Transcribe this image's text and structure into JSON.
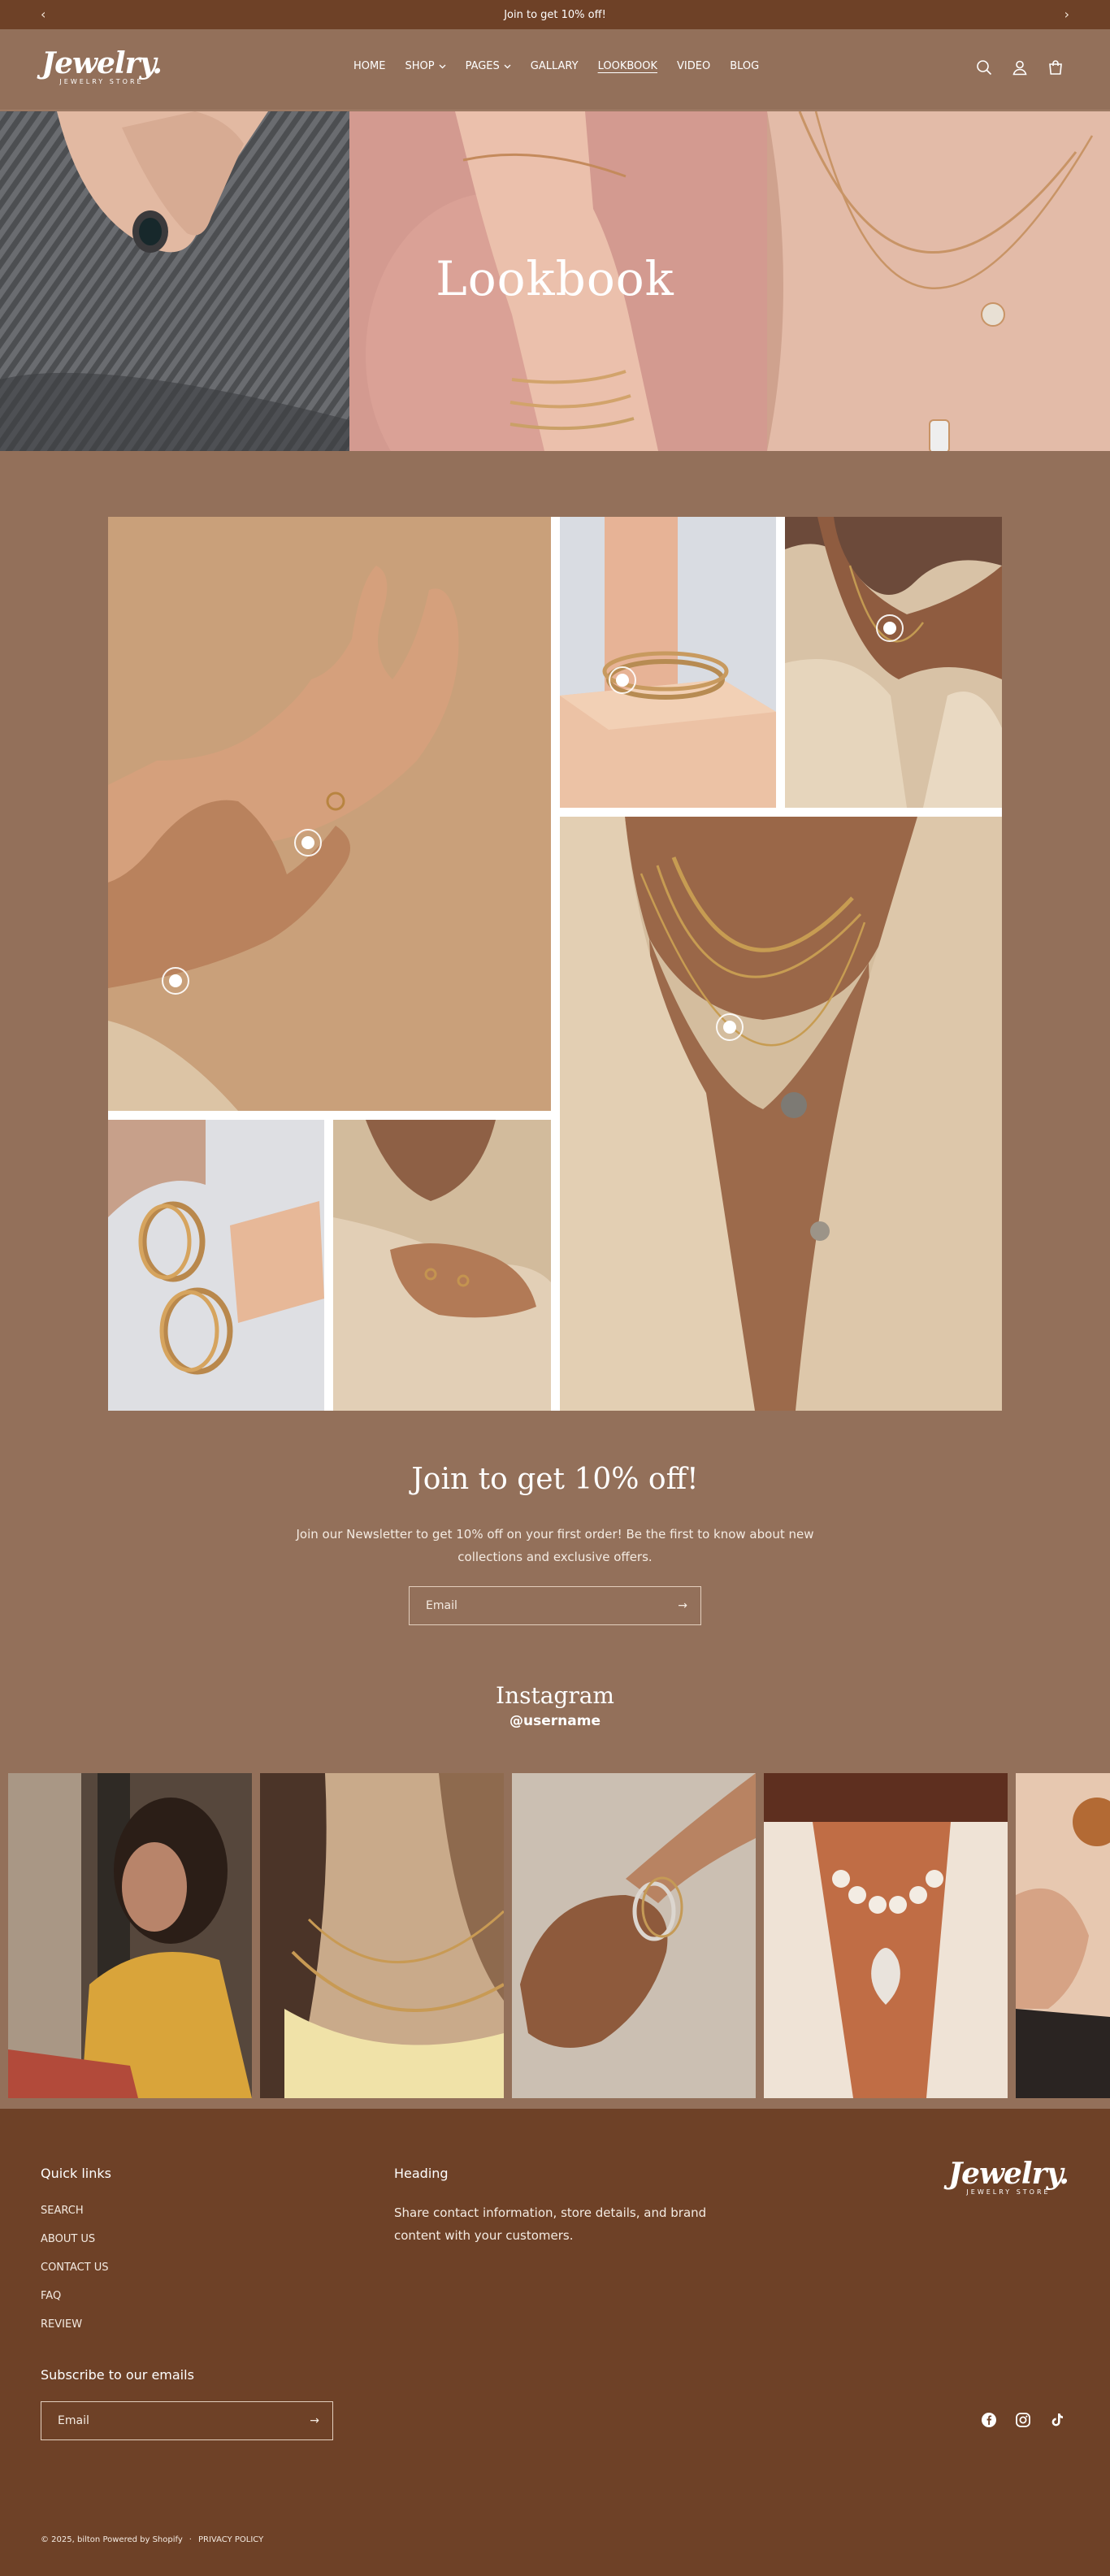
{
  "announcement": {
    "text": "Join to get 10% off!",
    "prev_icon": "chevron-left",
    "next_icon": "chevron-right"
  },
  "brand": {
    "name": "Jewelry.",
    "tagline": "JEWELRY STORE"
  },
  "nav": {
    "items": [
      {
        "label": "HOME",
        "dropdown": false,
        "active": false
      },
      {
        "label": "SHOP",
        "dropdown": true,
        "active": false
      },
      {
        "label": "PAGES",
        "dropdown": true,
        "active": false
      },
      {
        "label": "GALLARY",
        "dropdown": false,
        "active": false
      },
      {
        "label": "LOOKBOOK",
        "dropdown": false,
        "active": true
      },
      {
        "label": "VIDEO",
        "dropdown": false,
        "active": false
      },
      {
        "label": "BLOG",
        "dropdown": false,
        "active": false
      }
    ],
    "icons": [
      "search-icon",
      "account-icon",
      "cart-icon"
    ]
  },
  "hero": {
    "title": "Lookbook"
  },
  "newsletter": {
    "title": "Join to get 10% off!",
    "text": "Join our Newsletter to get 10% off on your first order! Be the first to know about new collections and exclusive offers.",
    "email_placeholder": "Email"
  },
  "instagram": {
    "title": "Instagram",
    "handle": "@username"
  },
  "footer": {
    "quick_links_heading": "Quick links",
    "quick_links": [
      "SEARCH",
      "ABOUT US",
      "CONTACT US",
      "FAQ",
      "REVIEW"
    ],
    "heading": "Heading",
    "text": "Share contact information, store details, and brand content with your customers.",
    "subscribe_heading": "Subscribe to our emails",
    "email_placeholder": "Email",
    "copyright": "© 2025, bilton Powered by Shopify",
    "separator": "·",
    "policy": "PRIVACY POLICY",
    "socials": [
      "facebook-icon",
      "instagram-icon",
      "tiktok-icon"
    ]
  },
  "colors": {
    "announcement_bg": "#6e4127",
    "page_bg": "#93705a",
    "footer_bg": "#6e4127",
    "text": "#ffffff"
  }
}
